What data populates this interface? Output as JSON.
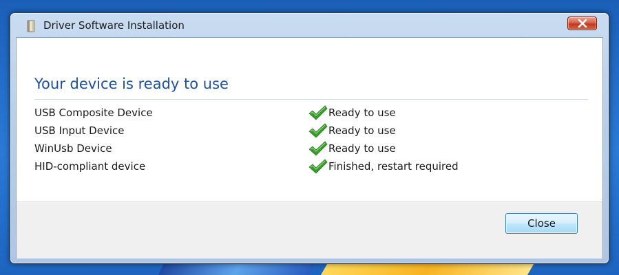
{
  "window": {
    "title": "Driver Software Installation",
    "icon": "driver-package-icon",
    "close_icon": "close-icon"
  },
  "heading": "Your device is ready to use",
  "devices": [
    {
      "name": "USB Composite Device",
      "status": "Ready to use",
      "icon": "check-icon"
    },
    {
      "name": "USB Input Device",
      "status": "Ready to use",
      "icon": "check-icon"
    },
    {
      "name": "WinUsb Device",
      "status": "Ready to use",
      "icon": "check-icon"
    },
    {
      "name": "HID-compliant device",
      "status": "Finished, restart required",
      "icon": "check-icon"
    }
  ],
  "footer": {
    "close_label": "Close"
  },
  "colors": {
    "heading": "#1e4f9c",
    "check": "#3a9a2e",
    "close_x": "#c2391f"
  }
}
